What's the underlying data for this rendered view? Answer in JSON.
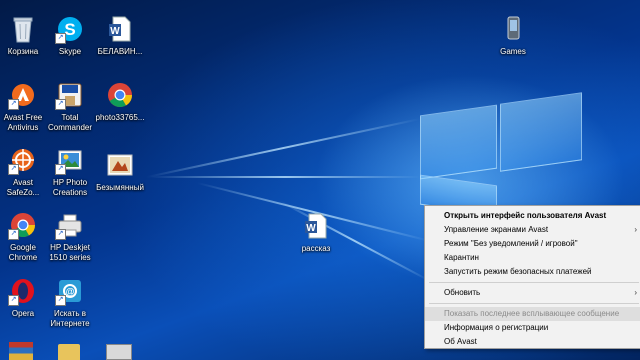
{
  "desktop": {
    "icons": [
      {
        "label": "Корзина",
        "icon": "recycle-bin-icon"
      },
      {
        "label": "Skype",
        "icon": "skype-icon"
      },
      {
        "label": "БЕЛАВИН...",
        "icon": "word-document-icon"
      },
      {
        "label": "Games",
        "icon": "games-icon"
      },
      {
        "label": "Avast Free\nAntivirus",
        "icon": "avast-icon"
      },
      {
        "label": "Total\nCommander",
        "icon": "total-commander-icon"
      },
      {
        "label": "photo33765...",
        "icon": "chrome-icon"
      },
      {
        "label": "Avast\nSafeZo...",
        "icon": "avast-safezone-icon"
      },
      {
        "label": "HP Photo\nCreations",
        "icon": "hp-photo-icon"
      },
      {
        "label": "Безымянный",
        "icon": "image-file-icon"
      },
      {
        "label": "Google\nChrome",
        "icon": "chrome-icon"
      },
      {
        "label": "HP Deskjet\n1510 series",
        "icon": "printer-icon"
      },
      {
        "label": "рассказ",
        "icon": "word-document-icon"
      },
      {
        "label": "Opera",
        "icon": "opera-icon"
      },
      {
        "label": "Искать в\nИнтернете",
        "icon": "search-web-icon"
      }
    ]
  },
  "context_menu": {
    "items": [
      {
        "label": "Открыть интерфейс пользователя Avast",
        "bold": true
      },
      {
        "label": "Управление экранами Avast",
        "submenu": true
      },
      {
        "label": "Режим \"Без уведомлений / игровой\""
      },
      {
        "label": "Карантин"
      },
      {
        "label": "Запустить режим безопасных платежей"
      },
      {
        "label": "Обновить",
        "submenu": true
      },
      {
        "label": "Показать последнее всплывающее сообщение",
        "disabled": true
      },
      {
        "label": "Информация о регистрации"
      },
      {
        "label": "Об Avast"
      }
    ],
    "submenu_arrow": "›"
  },
  "colors": {
    "avast_orange": "#f26b1d",
    "chrome_red": "#db4437",
    "chrome_yellow": "#f4c20d",
    "chrome_green": "#0f9d58",
    "chrome_blue": "#4285f4",
    "skype_blue": "#00aff0",
    "word_blue": "#2b579a",
    "opera_red": "#e0121d"
  }
}
